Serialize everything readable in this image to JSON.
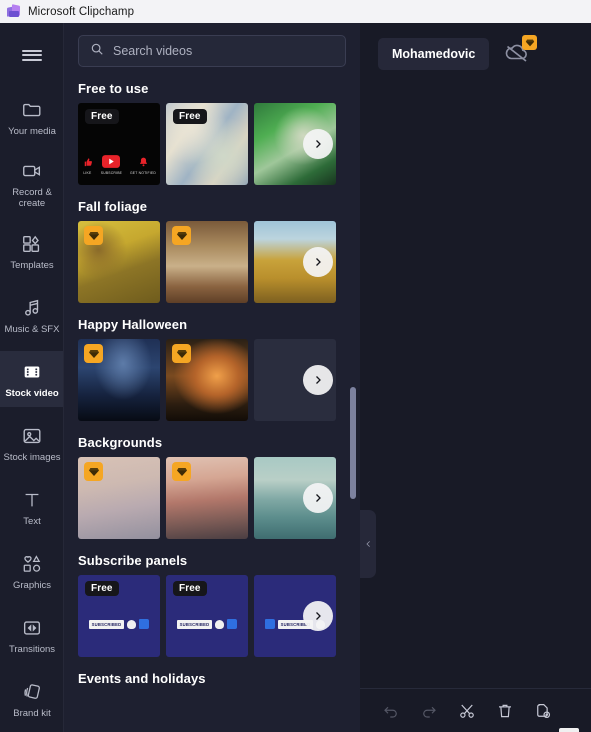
{
  "window": {
    "title": "Microsoft Clipchamp",
    "logo_icon": "clipchamp-logo-icon"
  },
  "rail": {
    "menu_icon": "hamburger-menu-icon",
    "items": [
      {
        "label": "Your media",
        "icon": "folder-icon",
        "active": false
      },
      {
        "label": "Record & create",
        "icon": "video-camera-icon",
        "active": false
      },
      {
        "label": "Templates",
        "icon": "templates-grid-icon",
        "active": false
      },
      {
        "label": "Music & SFX",
        "icon": "music-note-icon",
        "active": false
      },
      {
        "label": "Stock video",
        "icon": "film-strip-icon",
        "active": true
      },
      {
        "label": "Stock images",
        "icon": "photo-icon",
        "active": false
      },
      {
        "label": "Text",
        "icon": "text-t-icon",
        "active": false
      },
      {
        "label": "Graphics",
        "icon": "shapes-icon",
        "active": false
      },
      {
        "label": "Transitions",
        "icon": "transitions-icon",
        "active": false
      },
      {
        "label": "Brand kit",
        "icon": "brand-kit-icon",
        "active": false
      }
    ]
  },
  "library": {
    "search": {
      "placeholder": "Search videos",
      "value": "",
      "icon": "search-icon"
    },
    "next_arrow_icon": "chevron-right-icon",
    "badge_free_label": "Free",
    "premium_icon": "diamond-premium-icon",
    "sections": [
      {
        "title": "Free to use",
        "cards": [
          {
            "thumb": "t-yt",
            "badge": "free",
            "caption_like": "LIKE",
            "caption_subscribe": "SUBSCRIBE",
            "caption_notify": "GET NOTIFIED"
          },
          {
            "thumb": "t-iri",
            "badge": "free"
          },
          {
            "thumb": "t-green",
            "badge": "none"
          }
        ]
      },
      {
        "title": "Fall foliage",
        "cards": [
          {
            "thumb": "t-fall1",
            "badge": "premium"
          },
          {
            "thumb": "t-fall2",
            "badge": "premium"
          },
          {
            "thumb": "t-fall3",
            "badge": "none"
          }
        ]
      },
      {
        "title": "Happy Halloween",
        "cards": [
          {
            "thumb": "t-hw1",
            "badge": "premium"
          },
          {
            "thumb": "t-hw2",
            "badge": "premium"
          },
          {
            "thumb": "t-hw3",
            "badge": "none"
          }
        ]
      },
      {
        "title": "Backgrounds",
        "cards": [
          {
            "thumb": "t-bg1",
            "badge": "premium"
          },
          {
            "thumb": "t-bg2",
            "badge": "premium"
          },
          {
            "thumb": "t-bg3",
            "badge": "none"
          }
        ]
      },
      {
        "title": "Subscribe panels",
        "cards": [
          {
            "thumb": "t-sub",
            "badge": "free",
            "pill_text": "SUBSCRIBED"
          },
          {
            "thumb": "t-sub",
            "badge": "free",
            "pill_text": "SUBSCRIBED"
          },
          {
            "thumb": "t-sub",
            "badge": "none",
            "pill_text": "SUBSCRIBED"
          }
        ]
      },
      {
        "title": "Events and holidays",
        "cards": []
      }
    ]
  },
  "workspace": {
    "user_button_label": "Mohamedovic",
    "cloud_icon": "cloud-off-icon",
    "cloud_premium_icon": "diamond-premium-icon",
    "collapse_icon": "chevron-left-icon",
    "toolbar": [
      {
        "name": "undo-button",
        "icon": "undo-arrow-icon",
        "disabled": true
      },
      {
        "name": "redo-button",
        "icon": "redo-arrow-icon",
        "disabled": true
      },
      {
        "name": "split-button",
        "icon": "scissors-icon",
        "disabled": false
      },
      {
        "name": "delete-button",
        "icon": "trash-icon",
        "disabled": false
      },
      {
        "name": "duplicate-button",
        "icon": "duplicate-page-icon",
        "disabled": false
      }
    ]
  },
  "colors": {
    "accent_premium": "#f5a623",
    "panel_bg": "#1e2030",
    "rail_bg": "#1b1d2b",
    "workspace_bg": "#181a26",
    "titlebar_bg": "#f3f3f6"
  }
}
